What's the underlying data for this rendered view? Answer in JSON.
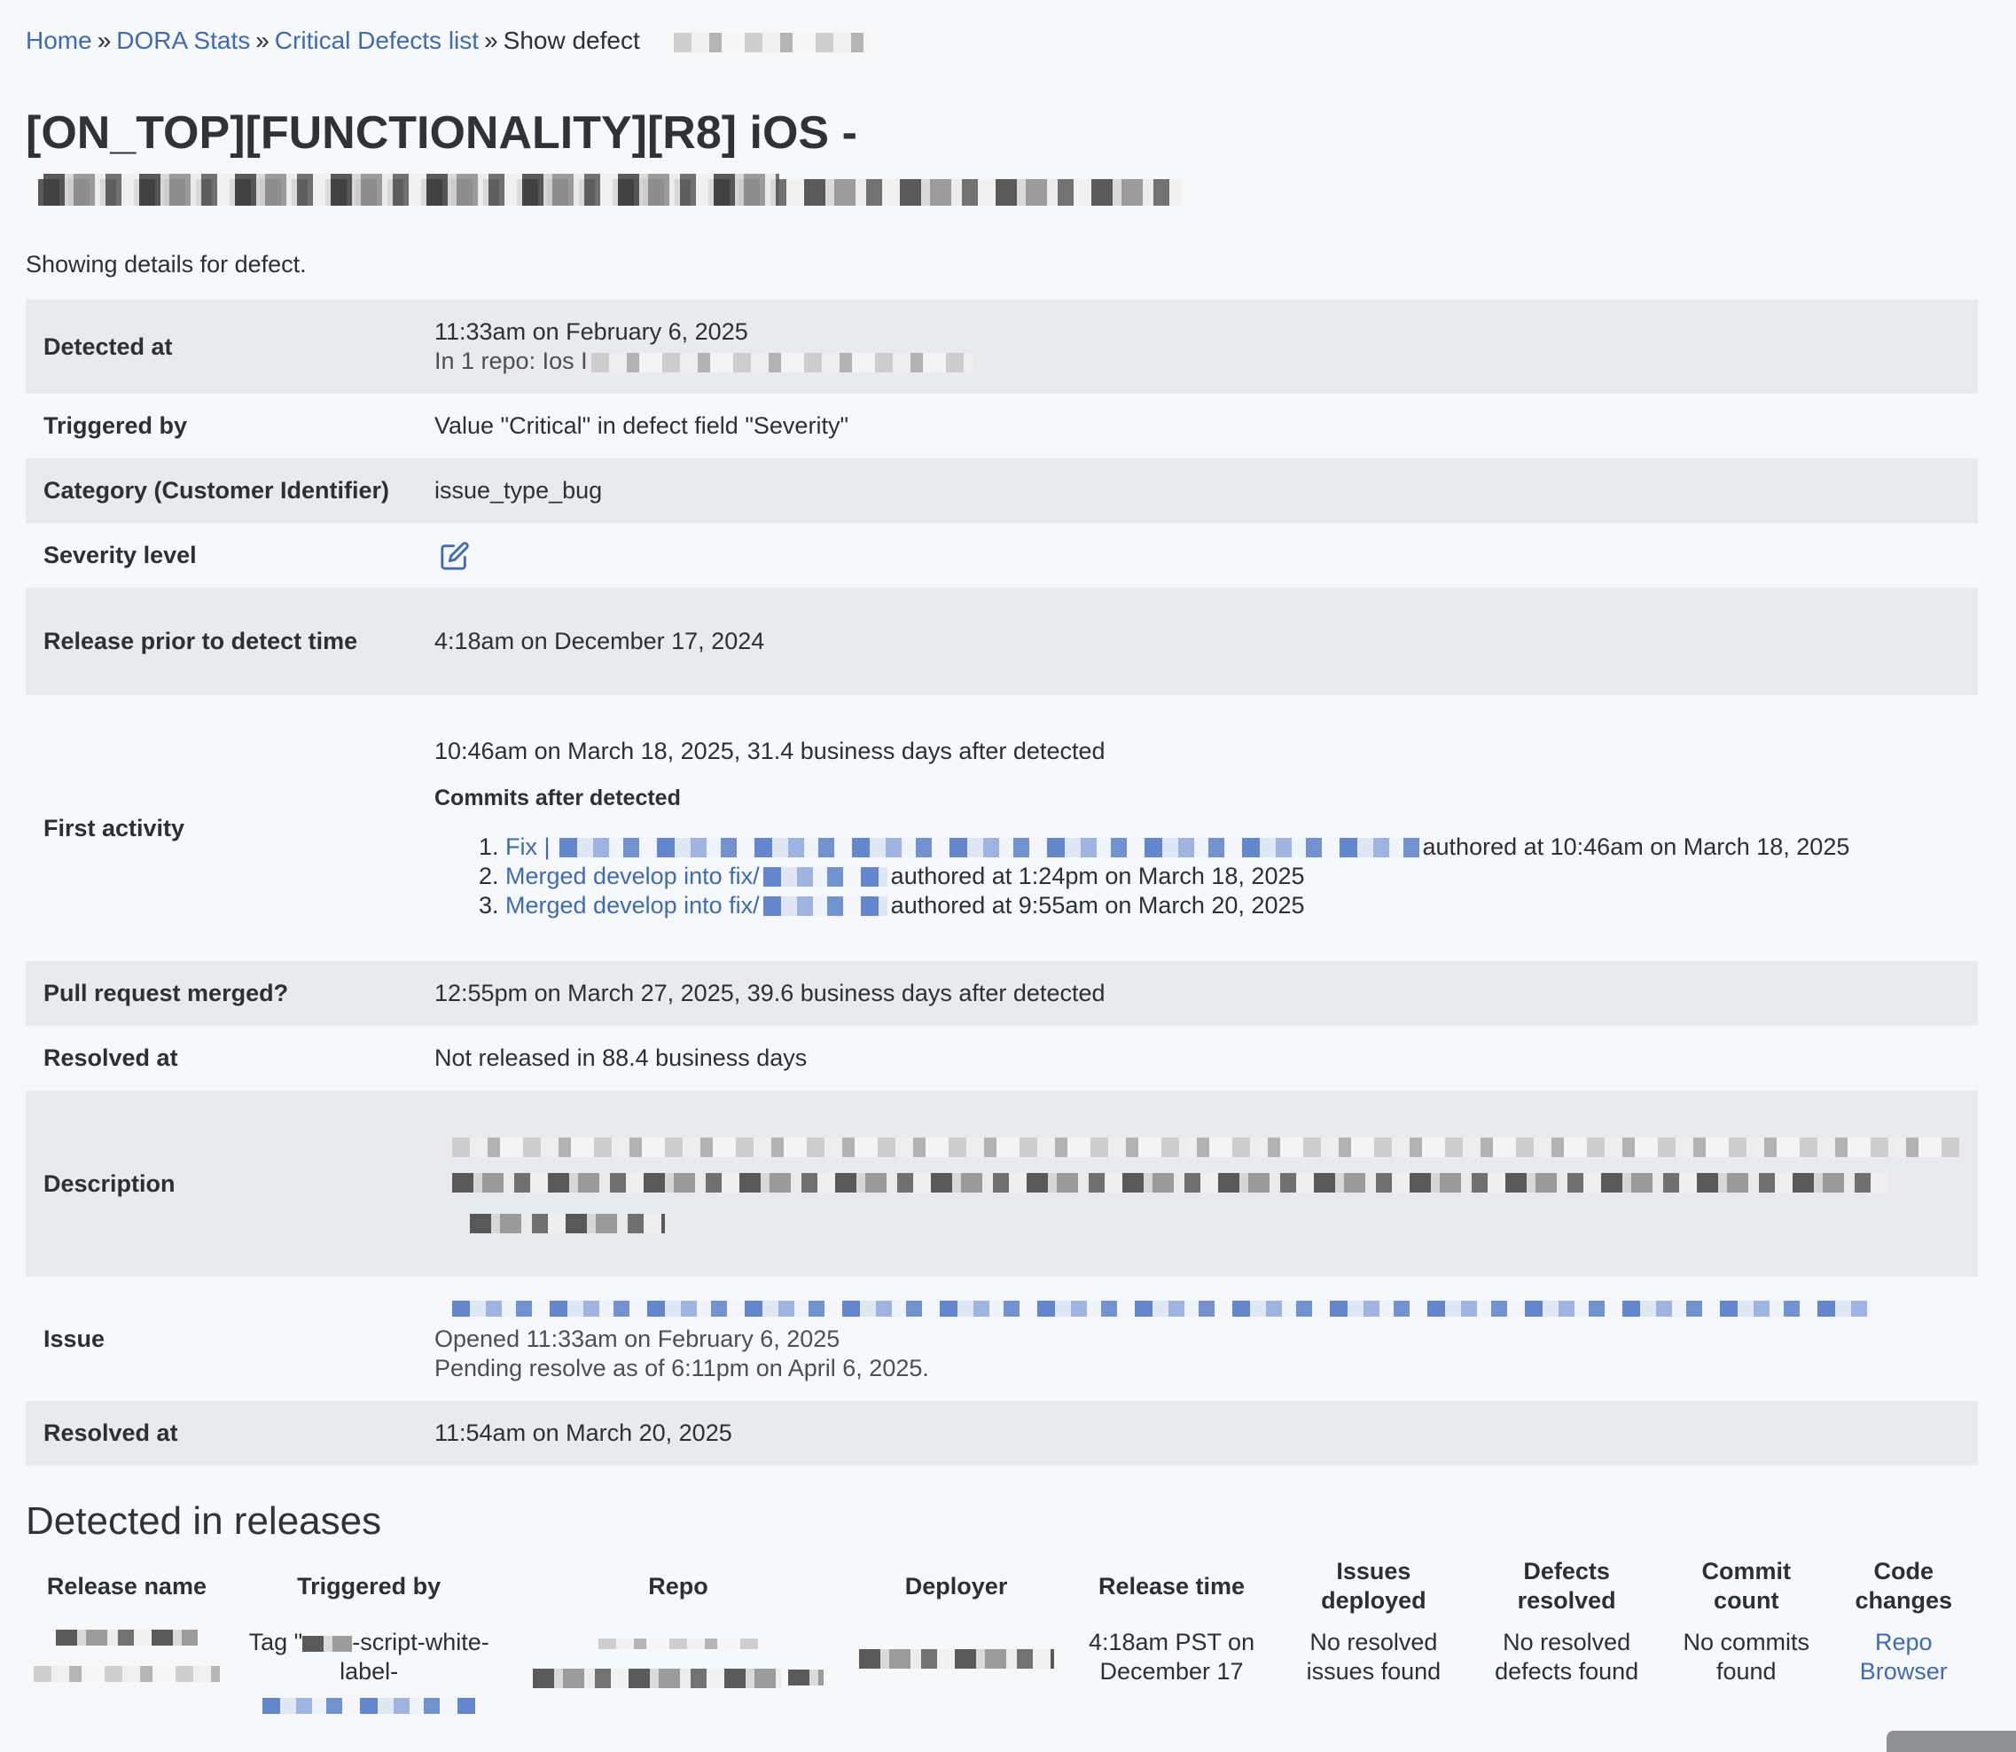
{
  "breadcrumb": {
    "home": "Home",
    "dora_stats": "DORA Stats",
    "critical_defects_list": "Critical Defects list",
    "current": "Show defect",
    "separator": "»"
  },
  "title": "[ON_TOP][FUNCTIONALITY][R8] iOS -",
  "subtitle": "Showing details for defect.",
  "details": {
    "detected_at": {
      "label": "Detected at",
      "value": "11:33am on February 6, 2025",
      "repo_prefix": "In 1 repo: Ios I"
    },
    "triggered_by": {
      "label": "Triggered by",
      "value": "Value \"Critical\" in defect field \"Severity\""
    },
    "category": {
      "label": "Category (Customer Identifier)",
      "value": "issue_type_bug"
    },
    "severity_level": {
      "label": "Severity level",
      "icon": "edit-icon"
    },
    "release_prior": {
      "label": "Release prior to detect time",
      "value": "4:18am on December 17, 2024"
    },
    "first_activity": {
      "label": "First activity",
      "value": "10:46am on March 18, 2025, 31.4 business days after detected",
      "commits_heading": "Commits after detected",
      "commits": [
        {
          "link": "Fix |",
          "authored": "authored at 10:46am on March 18, 2025"
        },
        {
          "link": "Merged develop into fix/",
          "authored": "authored at 1:24pm on March 18, 2025"
        },
        {
          "link": "Merged develop into fix/",
          "authored": "authored at 9:55am on March 20, 2025"
        }
      ]
    },
    "pull_request": {
      "label": "Pull request merged?",
      "value": "12:55pm on March 27, 2025, 39.6 business days after detected"
    },
    "resolved_at_1": {
      "label": "Resolved at",
      "value": "Not released in 88.4 business days"
    },
    "description": {
      "label": "Description"
    },
    "issue": {
      "label": "Issue",
      "opened": "Opened 11:33am on February 6, 2025",
      "pending": "Pending resolve as of 6:11pm on April 6, 2025."
    },
    "resolved_at_2": {
      "label": "Resolved at",
      "value": "11:54am on March 20, 2025"
    }
  },
  "releases": {
    "title": "Detected in releases",
    "columns": [
      "Release name",
      "Triggered by",
      "Repo",
      "Deployer",
      "Release time",
      "Issues deployed",
      "Defects resolved",
      "Commit count",
      "Code changes"
    ],
    "rows": [
      {
        "triggered_prefix": "Tag \"",
        "triggered_suffix": "-script-white-label-",
        "release_time": "4:18am PST on December 17",
        "issues_deployed": "No resolved issues found",
        "defects_resolved": "No resolved defects found",
        "commit_count": "No commits found",
        "code_changes": "Repo Browser"
      }
    ]
  },
  "colors": {
    "link": "#3f6bb5",
    "row_shade": "#e9eaed",
    "background": "#f7f8fa",
    "text": "#2c2f33"
  }
}
